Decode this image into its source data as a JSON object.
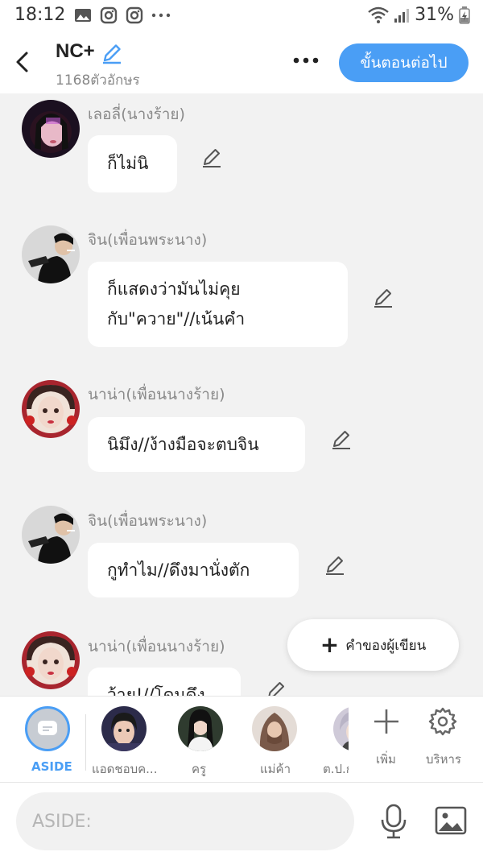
{
  "status_bar": {
    "time": "18:12",
    "battery": "31%"
  },
  "header": {
    "title": "NC+",
    "char_count": "1168ตัวอักษร",
    "next_button": "ขั้นตอนต่อไป"
  },
  "messages": [
    {
      "name": "เลอลี่(นางร้าย)",
      "lines": [
        "ก็ไม่นิ"
      ]
    },
    {
      "name": "จิน(เพื่อนพระนาง)",
      "lines": [
        "ก็แสดงว่ามันไม่คุย",
        "กับ\"ควาย\"//เน้นคำ"
      ]
    },
    {
      "name": "นาน่า(เพื่อนนางร้าย)",
      "lines": [
        "นิมึง//ง้างมือจะตบจิน"
      ]
    },
    {
      "name": "จิน(เพื่อนพระนาง)",
      "lines": [
        "กูทำไม//ดึงมานั่งตัก"
      ]
    },
    {
      "name": "นาน่า(เพื่อนนางร้าย)",
      "lines": [
        "ว้าย!//โดนดึง"
      ]
    }
  ],
  "fab": {
    "label": "คำของผู้เขียน"
  },
  "characters": {
    "aside": "ASIDE",
    "items": [
      "แอดชอบค...",
      "ครู",
      "แม่ค้า",
      "ต.ป.ก"
    ],
    "add": "เพิ่ม",
    "manage": "บริหาร"
  },
  "input": {
    "placeholder": "ASIDE:"
  }
}
